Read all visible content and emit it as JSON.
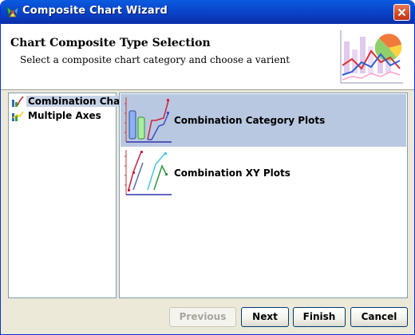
{
  "window": {
    "title": "Composite Chart Wizard",
    "accent_color": "#0a5be0",
    "close_icon": "close-icon"
  },
  "header": {
    "title": "Chart Composite Type Selection",
    "subtitle": "Select a composite chart category and choose a varient",
    "art_icon": "composite-chart-illustration"
  },
  "categories": [
    {
      "label": "Combination Chart",
      "selected": true,
      "icon": "combination-chart-icon"
    },
    {
      "label": "Multiple Axes",
      "selected": false,
      "icon": "multiple-axes-icon"
    }
  ],
  "types": [
    {
      "label": "Combination Category Plots",
      "selected": true,
      "icon": "category-plot-icon"
    },
    {
      "label": "Combination XY Plots",
      "selected": false,
      "icon": "xy-plot-icon"
    }
  ],
  "buttons": {
    "previous": {
      "label": "Previous",
      "enabled": false
    },
    "next": {
      "label": "Next",
      "enabled": true
    },
    "finish": {
      "label": "Finish",
      "enabled": true
    },
    "cancel": {
      "label": "Cancel",
      "enabled": true
    }
  },
  "selection_color": "#b8c8e0"
}
